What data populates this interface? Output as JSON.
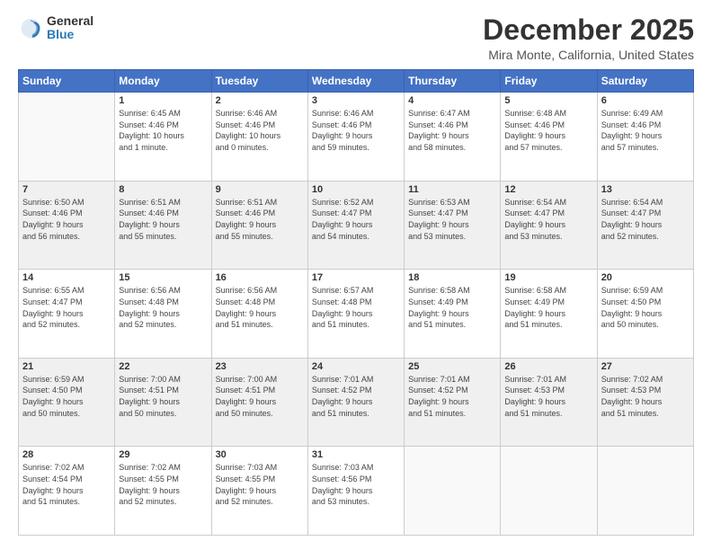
{
  "logo": {
    "general": "General",
    "blue": "Blue"
  },
  "header": {
    "month": "December 2025",
    "location": "Mira Monte, California, United States"
  },
  "weekdays": [
    "Sunday",
    "Monday",
    "Tuesday",
    "Wednesday",
    "Thursday",
    "Friday",
    "Saturday"
  ],
  "weeks": [
    [
      {
        "day": "",
        "info": ""
      },
      {
        "day": "1",
        "info": "Sunrise: 6:45 AM\nSunset: 4:46 PM\nDaylight: 10 hours\nand 1 minute."
      },
      {
        "day": "2",
        "info": "Sunrise: 6:46 AM\nSunset: 4:46 PM\nDaylight: 10 hours\nand 0 minutes."
      },
      {
        "day": "3",
        "info": "Sunrise: 6:46 AM\nSunset: 4:46 PM\nDaylight: 9 hours\nand 59 minutes."
      },
      {
        "day": "4",
        "info": "Sunrise: 6:47 AM\nSunset: 4:46 PM\nDaylight: 9 hours\nand 58 minutes."
      },
      {
        "day": "5",
        "info": "Sunrise: 6:48 AM\nSunset: 4:46 PM\nDaylight: 9 hours\nand 57 minutes."
      },
      {
        "day": "6",
        "info": "Sunrise: 6:49 AM\nSunset: 4:46 PM\nDaylight: 9 hours\nand 57 minutes."
      }
    ],
    [
      {
        "day": "7",
        "info": "Sunrise: 6:50 AM\nSunset: 4:46 PM\nDaylight: 9 hours\nand 56 minutes."
      },
      {
        "day": "8",
        "info": "Sunrise: 6:51 AM\nSunset: 4:46 PM\nDaylight: 9 hours\nand 55 minutes."
      },
      {
        "day": "9",
        "info": "Sunrise: 6:51 AM\nSunset: 4:46 PM\nDaylight: 9 hours\nand 55 minutes."
      },
      {
        "day": "10",
        "info": "Sunrise: 6:52 AM\nSunset: 4:47 PM\nDaylight: 9 hours\nand 54 minutes."
      },
      {
        "day": "11",
        "info": "Sunrise: 6:53 AM\nSunset: 4:47 PM\nDaylight: 9 hours\nand 53 minutes."
      },
      {
        "day": "12",
        "info": "Sunrise: 6:54 AM\nSunset: 4:47 PM\nDaylight: 9 hours\nand 53 minutes."
      },
      {
        "day": "13",
        "info": "Sunrise: 6:54 AM\nSunset: 4:47 PM\nDaylight: 9 hours\nand 52 minutes."
      }
    ],
    [
      {
        "day": "14",
        "info": "Sunrise: 6:55 AM\nSunset: 4:47 PM\nDaylight: 9 hours\nand 52 minutes."
      },
      {
        "day": "15",
        "info": "Sunrise: 6:56 AM\nSunset: 4:48 PM\nDaylight: 9 hours\nand 52 minutes."
      },
      {
        "day": "16",
        "info": "Sunrise: 6:56 AM\nSunset: 4:48 PM\nDaylight: 9 hours\nand 51 minutes."
      },
      {
        "day": "17",
        "info": "Sunrise: 6:57 AM\nSunset: 4:48 PM\nDaylight: 9 hours\nand 51 minutes."
      },
      {
        "day": "18",
        "info": "Sunrise: 6:58 AM\nSunset: 4:49 PM\nDaylight: 9 hours\nand 51 minutes."
      },
      {
        "day": "19",
        "info": "Sunrise: 6:58 AM\nSunset: 4:49 PM\nDaylight: 9 hours\nand 51 minutes."
      },
      {
        "day": "20",
        "info": "Sunrise: 6:59 AM\nSunset: 4:50 PM\nDaylight: 9 hours\nand 50 minutes."
      }
    ],
    [
      {
        "day": "21",
        "info": "Sunrise: 6:59 AM\nSunset: 4:50 PM\nDaylight: 9 hours\nand 50 minutes."
      },
      {
        "day": "22",
        "info": "Sunrise: 7:00 AM\nSunset: 4:51 PM\nDaylight: 9 hours\nand 50 minutes."
      },
      {
        "day": "23",
        "info": "Sunrise: 7:00 AM\nSunset: 4:51 PM\nDaylight: 9 hours\nand 50 minutes."
      },
      {
        "day": "24",
        "info": "Sunrise: 7:01 AM\nSunset: 4:52 PM\nDaylight: 9 hours\nand 51 minutes."
      },
      {
        "day": "25",
        "info": "Sunrise: 7:01 AM\nSunset: 4:52 PM\nDaylight: 9 hours\nand 51 minutes."
      },
      {
        "day": "26",
        "info": "Sunrise: 7:01 AM\nSunset: 4:53 PM\nDaylight: 9 hours\nand 51 minutes."
      },
      {
        "day": "27",
        "info": "Sunrise: 7:02 AM\nSunset: 4:53 PM\nDaylight: 9 hours\nand 51 minutes."
      }
    ],
    [
      {
        "day": "28",
        "info": "Sunrise: 7:02 AM\nSunset: 4:54 PM\nDaylight: 9 hours\nand 51 minutes."
      },
      {
        "day": "29",
        "info": "Sunrise: 7:02 AM\nSunset: 4:55 PM\nDaylight: 9 hours\nand 52 minutes."
      },
      {
        "day": "30",
        "info": "Sunrise: 7:03 AM\nSunset: 4:55 PM\nDaylight: 9 hours\nand 52 minutes."
      },
      {
        "day": "31",
        "info": "Sunrise: 7:03 AM\nSunset: 4:56 PM\nDaylight: 9 hours\nand 53 minutes."
      },
      {
        "day": "",
        "info": ""
      },
      {
        "day": "",
        "info": ""
      },
      {
        "day": "",
        "info": ""
      }
    ]
  ]
}
